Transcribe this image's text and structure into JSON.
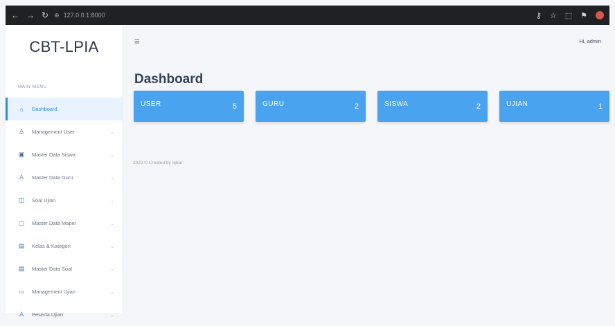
{
  "browser": {
    "address": "127.0.0.1:8000",
    "back_icon": "←",
    "forward_icon": "→",
    "reload_icon": "↻",
    "site_icon": "⊕",
    "right_icons": [
      "⚷",
      "☆",
      "⬚",
      "⚑"
    ]
  },
  "sidebar": {
    "brand": "CBT-LPIA",
    "menu_header": "MAIN MENU",
    "items": [
      {
        "icon": "⌂",
        "label": "Dashboard",
        "active": true
      },
      {
        "icon": "♙",
        "label": "Management User"
      },
      {
        "icon": "▣",
        "label": "Master Data Siswa"
      },
      {
        "icon": "♙",
        "label": "Master Data Guru"
      },
      {
        "icon": "◫",
        "label": "Soal Ujian"
      },
      {
        "icon": "▢",
        "label": "Master Data Mapel"
      },
      {
        "icon": "▤",
        "label": "Kelas & Kategori"
      },
      {
        "icon": "▤",
        "label": "Master Data Soal"
      },
      {
        "icon": "▭",
        "label": "Management Ujian"
      },
      {
        "icon": "♙",
        "label": "Peserta Ujian"
      }
    ],
    "chevron": "⌄"
  },
  "header": {
    "menu_icon": "≡",
    "user": "Hi, admin"
  },
  "page": {
    "title": "Dashboard"
  },
  "cards": [
    {
      "label": "USER",
      "value": "5"
    },
    {
      "label": "GURU",
      "value": "2"
    },
    {
      "label": "SISWA",
      "value": "2"
    },
    {
      "label": "UJIAN",
      "value": "1"
    }
  ],
  "footer": "2022 © Created by Iqbal",
  "colors": {
    "accent": "#2b8ce6",
    "card": "#4aa3ee"
  }
}
